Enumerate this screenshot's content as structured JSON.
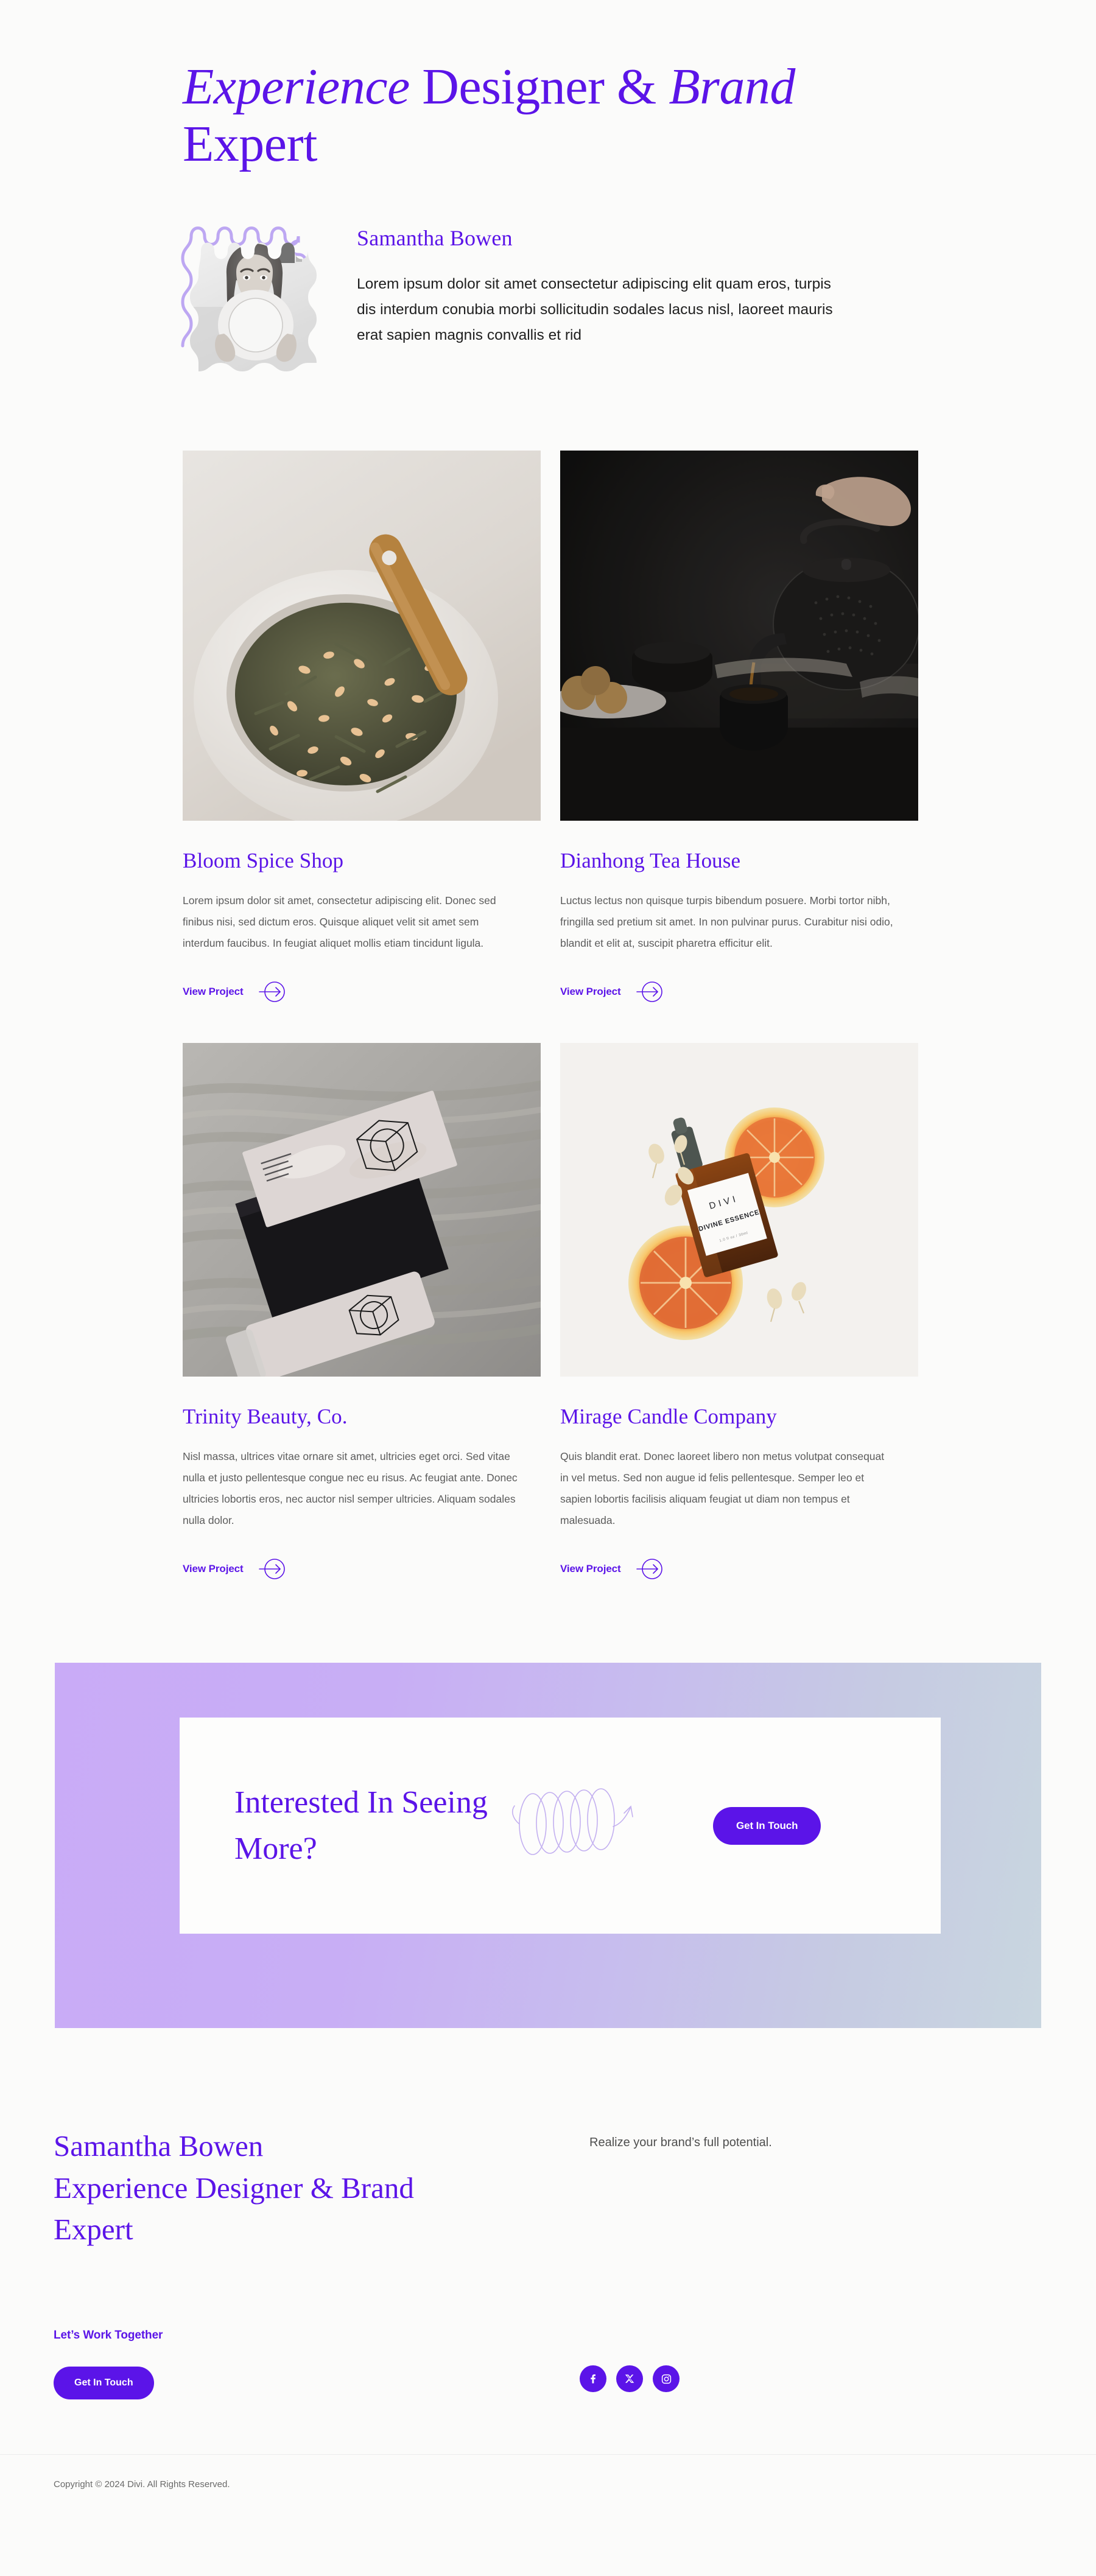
{
  "hero": {
    "title_part1": "Experience",
    "title_part2": " Designer & ",
    "title_part3": "Brand",
    "title_part4": " Expert"
  },
  "profile": {
    "name": "Samantha Bowen",
    "bio": "Lorem ipsum dolor sit amet consectetur adipiscing elit quam eros, turpis dis interdum conubia morbi sollicitudin sodales lacus nisl, laoreet mauris erat sapien magnis convallis et rid",
    "avatar_alt": "portrait-photo"
  },
  "projects": [
    {
      "title": "Bloom Spice Shop",
      "desc": "Lorem ipsum dolor sit amet, consectetur adipiscing elit. Donec sed finibus nisi, sed dictum eros. Quisque aliquet velit sit amet sem interdum faucibus. In feugiat aliquet mollis etiam tincidunt ligula.",
      "link_label": "View Project",
      "image_alt": "bowl-of-tea-leaves-with-wooden-spoon"
    },
    {
      "title": "Dianhong Tea House",
      "desc": "Luctus lectus non quisque turpis bibendum posuere. Morbi tortor nibh, fringilla sed pretium sit amet. In non pulvinar purus. Curabitur nisi odio, blandit et elit at, suscipit pharetra efficitur elit.",
      "link_label": "View Project",
      "image_alt": "dark-teapot-pouring-tea"
    },
    {
      "title": "Trinity Beauty, Co.",
      "desc": "Nisl massa, ultrices vitae ornare sit amet, ultricies eget orci. Sed vitae nulla et justo pellentesque congue nec eu risus. Ac feugiat ante. Donec ultricies lobortis eros, nec auctor nisl semper ultricies. Aliquam sodales nulla dolor.",
      "link_label": "View Project",
      "image_alt": "cosmetic-packaging-with-cube-logo"
    },
    {
      "title": "Mirage Candle Company",
      "desc": "Quis blandit erat. Donec laoreet libero non metus volutpat consequat in vel metus. Sed non augue id felis pellentesque. Semper leo et sapien lobortis facilisis aliquam feugiat ut diam non tempus et malesuada.",
      "link_label": "View Project",
      "image_alt": "serum-bottle-with-orange-slices"
    }
  ],
  "cta": {
    "title": "Interested In Seeing More?",
    "button_label": "Get In Touch",
    "decoration": "spiral-arrow-icon"
  },
  "footer": {
    "heading_line1": "Samantha Bowen",
    "heading_line2": "Experience Designer & Brand",
    "heading_line3": "Expert",
    "tagline": "Realize your brand’s full potential.",
    "lets_work": "Let’s Work Together",
    "button_label": "Get In Touch",
    "socials": [
      {
        "name": "facebook-icon",
        "label": "Facebook"
      },
      {
        "name": "x-twitter-icon",
        "label": "X"
      },
      {
        "name": "instagram-icon",
        "label": "Instagram"
      }
    ],
    "copyright": "Copyright © 2024 Divi. All Rights Reserved."
  },
  "theme": {
    "accent": "#5b14e8",
    "accent_soft": "#c3b0f0",
    "page_bg": "#fbfbfa",
    "body_text": "#5c5c5c",
    "gradient_from": "#c9abf7",
    "gradient_to": "#c9d6e0"
  }
}
